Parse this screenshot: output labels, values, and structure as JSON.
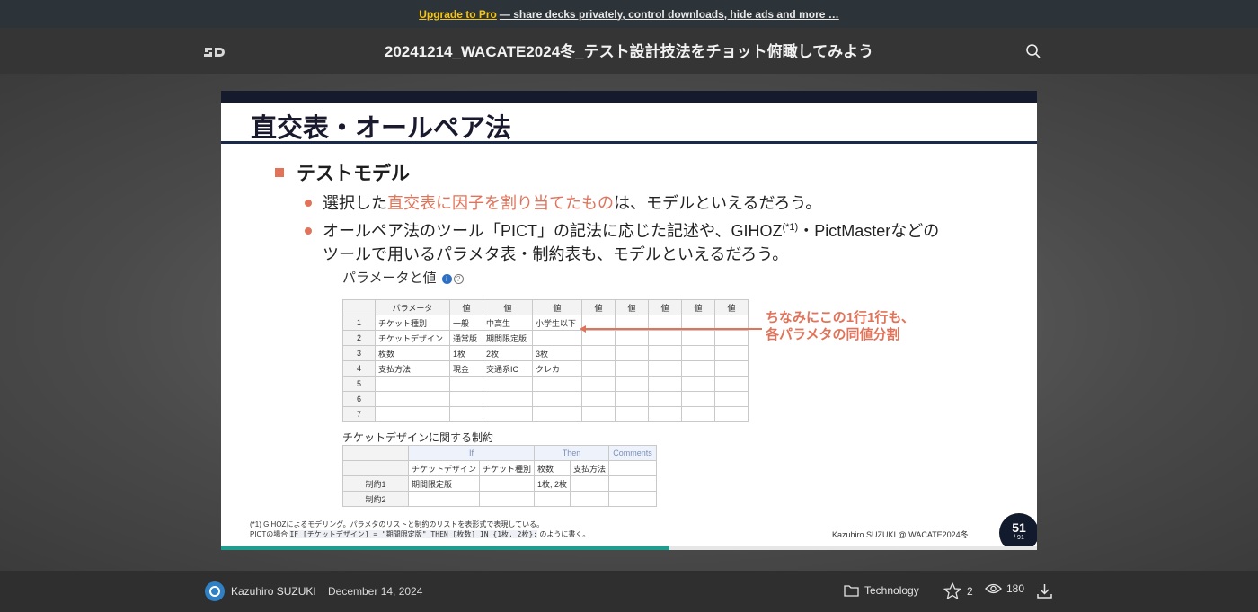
{
  "promo": {
    "link": "Upgrade to Pro",
    "text": "— share decks privately, control downloads, hide ads and more …"
  },
  "header": {
    "logo": "SD",
    "title": "20241214_WACATE2024冬_テスト設計技法をチョット俯瞰してみよう"
  },
  "slide": {
    "heading": "直交表・オールペア法",
    "section": "テストモデル",
    "b1_pre": "選択した",
    "b1_hl": "直交表に因子を割り当てたもの",
    "b1_post": "は、モデルといえるだろう。",
    "b2_l1_pre": "オールペア法のツール「PICT」の記法に応じた記述や、GIHOZ",
    "b2_sup": "(*1)",
    "b2_l1_post": "・PictMasterなどの",
    "b2_l2": "ツールで用いるパラメタ表・制約表も、モデルといえるだろう。",
    "param_title": "パラメータと値",
    "param_table": {
      "header": [
        "",
        "パラメータ",
        "値",
        "値",
        "値",
        "値",
        "値",
        "値",
        "値",
        "値"
      ],
      "rows": [
        [
          "1",
          "チケット種別",
          "一般",
          "中高生",
          "小学生以下",
          "",
          "",
          "",
          "",
          ""
        ],
        [
          "2",
          "チケットデザイン",
          "通常版",
          "期間限定版",
          "",
          "",
          "",
          "",
          "",
          ""
        ],
        [
          "3",
          "枚数",
          "1枚",
          "2枚",
          "3枚",
          "",
          "",
          "",
          "",
          ""
        ],
        [
          "4",
          "支払方法",
          "現金",
          "交通系IC",
          "クレカ",
          "",
          "",
          "",
          "",
          ""
        ],
        [
          "5",
          "",
          "",
          "",
          "",
          "",
          "",
          "",
          "",
          ""
        ],
        [
          "6",
          "",
          "",
          "",
          "",
          "",
          "",
          "",
          "",
          ""
        ],
        [
          "7",
          "",
          "",
          "",
          "",
          "",
          "",
          "",
          "",
          ""
        ]
      ]
    },
    "note_l1": "ちなみにこの1行1行も、",
    "note_l2": "各パラメタの同値分割",
    "constraint_title": "チケットデザインに関する制約",
    "constraint_table": {
      "top": [
        "",
        "If",
        "Then",
        "Comments"
      ],
      "sub": [
        "",
        "チケットデザイン",
        "チケット種別",
        "枚数",
        "支払方法",
        ""
      ],
      "rows": [
        [
          "制約1",
          "期間限定版",
          "",
          "1枚, 2枚",
          "",
          ""
        ],
        [
          "制約2",
          "",
          "",
          "",
          "",
          ""
        ]
      ]
    },
    "foot_l1": "(*1) GIHOZによるモデリング。パラメタのリストと制約のリストを表形式で表現している。",
    "foot_l2_pre": "PICTの場合 ",
    "foot_code": "IF [チケットデザイン] = \"期間限定版\" THEN [枚数] IN {1枚, 2枚};",
    "foot_l2_post": " のように書く。",
    "author": "Kazuhiro SUZUKI @ WACATE2024冬",
    "page": "51",
    "total": "/ 91",
    "progress": 0.55
  },
  "footer": {
    "author": "Kazuhiro SUZUKI",
    "date": "December 14, 2024",
    "category": "Technology",
    "stars": "2",
    "views": "180"
  },
  "colors": {
    "accent": "#e0735a",
    "promo": "#f5c518",
    "progress": "#1f9e8f"
  }
}
